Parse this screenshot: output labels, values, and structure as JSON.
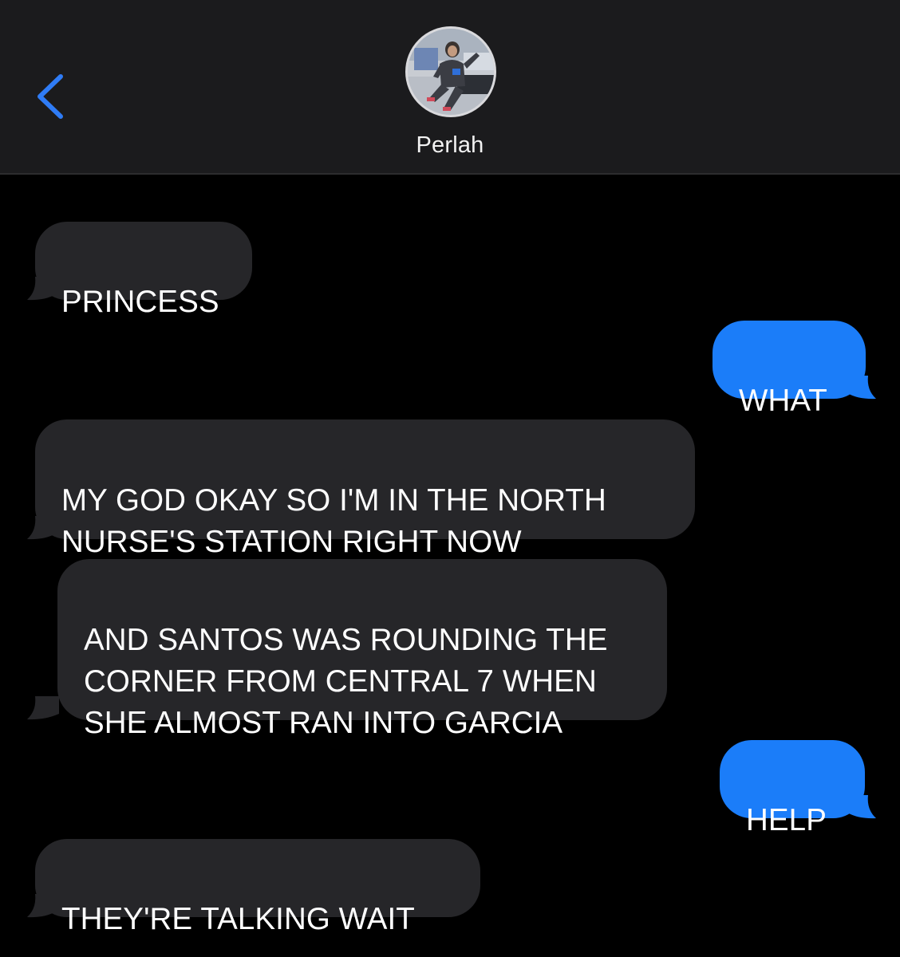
{
  "header": {
    "contact_name": "Perlah",
    "back_icon": "chevron-left-icon",
    "accent_color": "#2f7cf6"
  },
  "colors": {
    "received_bubble": "#262629",
    "sent_bubble": "#1b7df9",
    "background": "#000000",
    "header_background": "#1b1b1d"
  },
  "messages": [
    {
      "direction": "received",
      "text": "PRINCESS"
    },
    {
      "direction": "sent",
      "text": "WHAT"
    },
    {
      "direction": "received",
      "text": "MY GOD OKAY SO I'M IN THE NORTH\nNURSE'S STATION RIGHT NOW"
    },
    {
      "direction": "received",
      "text": "AND SANTOS WAS ROUNDING THE\nCORNER FROM CENTRAL 7 WHEN\nSHE ALMOST RAN INTO GARCIA"
    },
    {
      "direction": "sent",
      "text": "HELP"
    },
    {
      "direction": "received",
      "text": "THEY'RE TALKING WAIT"
    }
  ]
}
